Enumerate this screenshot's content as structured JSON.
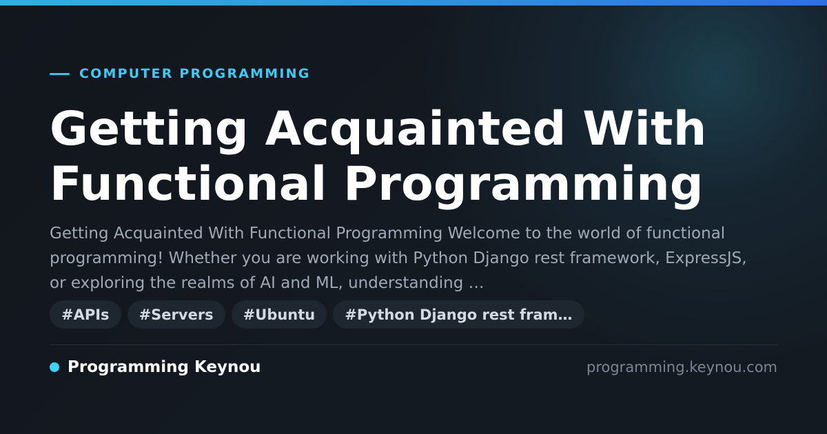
{
  "category": "COMPUTER PROGRAMMING",
  "title": "Getting Acquainted With Functional Programming",
  "excerpt": "Getting Acquainted With Functional Programming Welcome to the world of functional programming! Whether you are working with Python Django rest framework, ExpressJS, or exploring the realms of AI and ML, understanding …",
  "tags": [
    "#APIs",
    "#Servers",
    "#Ubuntu",
    "#Python Django rest fram…"
  ],
  "brand": {
    "name": "Programming Keynou",
    "url": "programming.keynou.com"
  },
  "colors": {
    "accent": "#38c6ee",
    "background": "#12171f",
    "title": "#ffffff",
    "excerpt": "#a0a8b4",
    "tag_background": "#1e2630"
  }
}
